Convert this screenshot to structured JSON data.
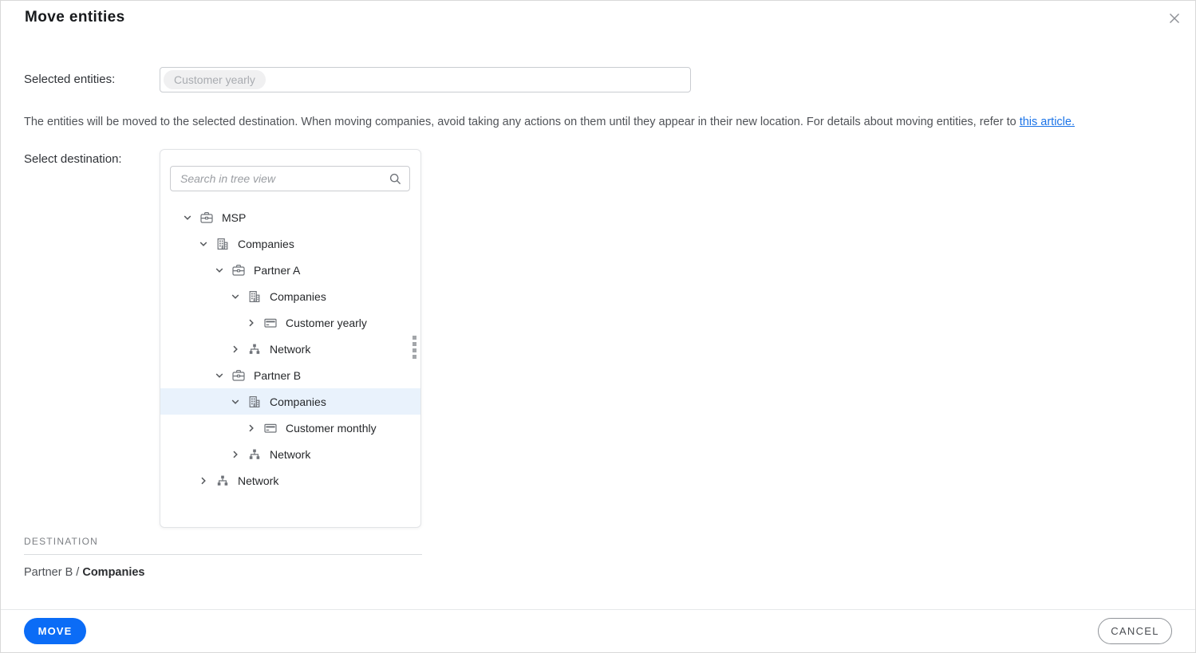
{
  "dialog": {
    "title": "Move entities"
  },
  "selected_entities": {
    "label": "Selected entities:",
    "chips": [
      "Customer yearly"
    ]
  },
  "description": {
    "text_before": "The entities will be moved to the selected destination. When moving companies, avoid taking any actions on them until they appear in their new location. For details about moving entities, refer to ",
    "link_text": "this article."
  },
  "destination_picker": {
    "label": "Select destination:",
    "search_placeholder": "Search in tree view",
    "tree": [
      {
        "label": "MSP",
        "icon": "partner-icon",
        "level": 0,
        "expanded": true,
        "selected": false
      },
      {
        "label": "Companies",
        "icon": "companies-icon",
        "level": 1,
        "expanded": true,
        "selected": false
      },
      {
        "label": "Partner A",
        "icon": "partner-icon",
        "level": 2,
        "expanded": true,
        "selected": false
      },
      {
        "label": "Companies",
        "icon": "companies-icon",
        "level": 3,
        "expanded": true,
        "selected": false
      },
      {
        "label": "Customer yearly",
        "icon": "customer-icon",
        "level": 4,
        "expanded": false,
        "selected": false
      },
      {
        "label": "Network",
        "icon": "network-icon",
        "level": 3,
        "expanded": false,
        "selected": false
      },
      {
        "label": "Partner B",
        "icon": "partner-icon",
        "level": 2,
        "expanded": true,
        "selected": false
      },
      {
        "label": "Companies",
        "icon": "companies-icon",
        "level": 3,
        "expanded": true,
        "selected": true
      },
      {
        "label": "Customer monthly",
        "icon": "customer-icon",
        "level": 4,
        "expanded": false,
        "selected": false
      },
      {
        "label": "Network",
        "icon": "network-icon",
        "level": 3,
        "expanded": false,
        "selected": false
      },
      {
        "label": "Network",
        "icon": "network-icon",
        "level": 1,
        "expanded": false,
        "selected": false
      }
    ]
  },
  "destination_summary": {
    "heading": "DESTINATION",
    "path_parent": "Partner B",
    "separator": " / ",
    "path_current": "Companies"
  },
  "footer": {
    "move_label": "MOVE",
    "cancel_label": "CANCEL"
  },
  "colors": {
    "accent_blue": "#0b6cf6",
    "link_blue": "#1a73e8",
    "selected_row_bg": "#e9f2fc",
    "chip_bg": "#f0f0f1"
  }
}
